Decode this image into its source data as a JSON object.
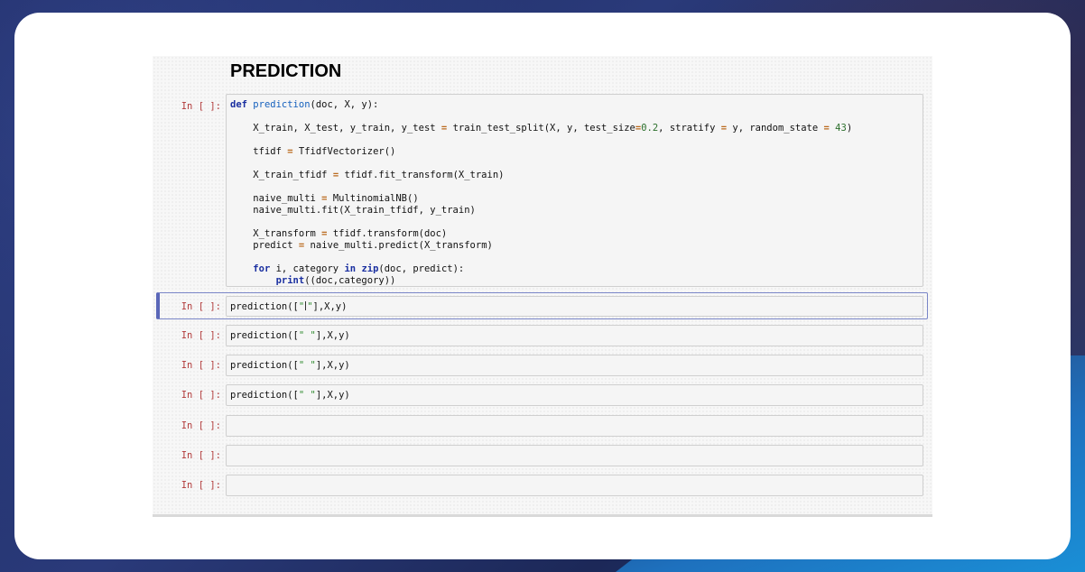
{
  "notebook": {
    "heading": "PREDICTION",
    "prompt_label": "In [ ]:",
    "def_cell": {
      "kw_def": "def",
      "fn_name": "prediction",
      "signature": "(doc, X, y):",
      "split_lhs": "X_train, X_test, y_train, y_test",
      "split_fn": "train_test_split(X, y, test_size",
      "test_size": "0.2",
      "stratify": ", stratify ",
      "stratify_val": " y, random_state ",
      "random_state": "43",
      "tfidf_lhs": "tfidf",
      "tfidf_rhs": "TfidfVectorizer()",
      "xtt_lhs": "X_train_tfidf",
      "xtt_rhs": "tfidf.fit_transform(X_train)",
      "nm_lhs": "naive_multi",
      "nm_rhs": "MultinomialNB()",
      "nm_fit": "naive_multi.fit(X_train_tfidf, y_train)",
      "xt_lhs": "X_transform",
      "xt_rhs": "tfidf.transform(doc)",
      "pred_lhs": "predict",
      "pred_rhs": "naive_multi.predict(X_transform)",
      "kw_for": "for",
      "for_vars": " i, category ",
      "kw_in": "in",
      "kw_zip": "zip",
      "for_rest": "(doc, predict):",
      "kw_print": "print",
      "print_args": "((doc,category))"
    },
    "call_cells": [
      {
        "pre": "prediction([",
        "str": "\" \"",
        "post": "],X,y)"
      },
      {
        "pre": "prediction([",
        "str": "\" \"",
        "post": "],X,y)"
      },
      {
        "pre": "prediction([",
        "str": "\" \"",
        "post": "],X,y)"
      },
      {
        "pre": "prediction([",
        "str": "\" \"",
        "post": "],X,y)"
      }
    ]
  }
}
